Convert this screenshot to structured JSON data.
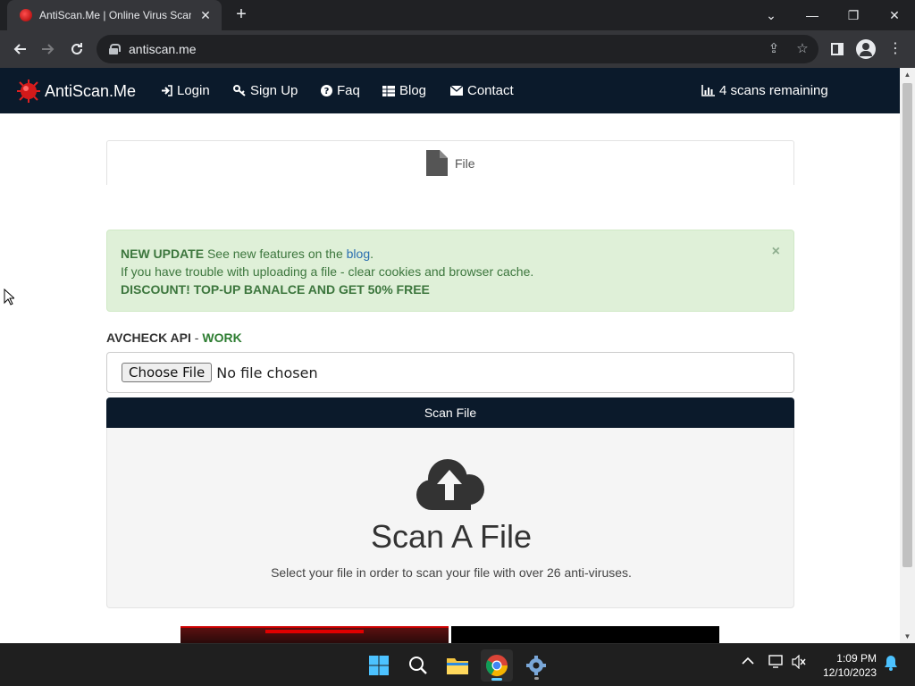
{
  "browser": {
    "tab_title": "AntiScan.Me | Online Virus Scanner",
    "tab_close": "✕",
    "new_tab": "+",
    "url": "antiscan.me",
    "window_controls": {
      "dropdown": "⌄",
      "minimize": "—",
      "restore": "❐",
      "close": "✕"
    }
  },
  "site_nav": {
    "brand": "AntiScan.Me",
    "links": [
      {
        "label": "Login",
        "icon": "sign-in-icon"
      },
      {
        "label": "Sign Up",
        "icon": "key-icon"
      },
      {
        "label": "Faq",
        "icon": "question-circle-icon"
      },
      {
        "label": "Blog",
        "icon": "table-icon"
      },
      {
        "label": "Contact",
        "icon": "envelope-icon"
      }
    ],
    "scans_remaining": "4 scans remaining"
  },
  "file_tab": {
    "label": "File"
  },
  "alert": {
    "new_update_label": "NEW UPDATE",
    "new_update_text": "See new features on the",
    "blog_link": "blog",
    "period": ".",
    "trouble_text": "If you have trouble with uploading a file - clear cookies and browser cache.",
    "discount_text": "DISCOUNT! TOP-UP BANALCE AND GET 50% FREE",
    "close": "×"
  },
  "api_status": {
    "label": "AVCHECK API",
    "separator": " - ",
    "value": "WORK"
  },
  "file_input": {
    "button": "Choose File",
    "status": "No file chosen"
  },
  "scan_button": "Scan File",
  "dropzone": {
    "title": "Scan A File",
    "subtitle": "Select your file in order to scan your file with over 26 anti-viruses."
  },
  "taskbar": {
    "time": "1:09 PM",
    "date": "12/10/2023"
  },
  "colors": {
    "navbar": "#0b1a2b",
    "alert_bg": "#dff0d8",
    "alert_text": "#3c763d",
    "api_ok": "#2e7d32"
  }
}
